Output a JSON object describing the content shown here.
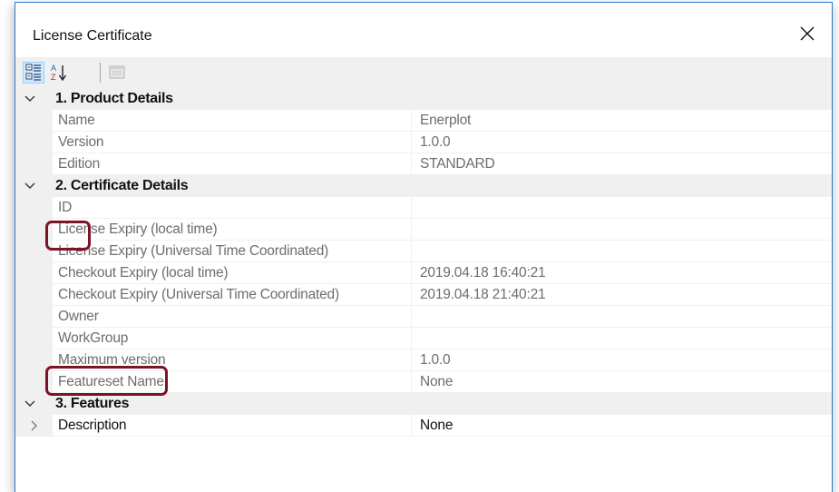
{
  "window": {
    "title": "License Certificate"
  },
  "toolbar": {
    "buttons": [
      "categorized-icon",
      "alphabetical-icon",
      "property-pages-icon"
    ]
  },
  "grid": {
    "categories": [
      {
        "label": "1. Product Details",
        "expanded": true,
        "rows": [
          {
            "name": "Name",
            "value": "Enerplot"
          },
          {
            "name": "Version",
            "value": "1.0.0"
          },
          {
            "name": "Edition",
            "value": "STANDARD"
          }
        ]
      },
      {
        "label": "2. Certificate Details",
        "expanded": true,
        "rows": [
          {
            "name": "ID",
            "value": ""
          },
          {
            "name": "License Expiry (local time)",
            "value": ""
          },
          {
            "name": "License Expiry (Universal Time Coordinated)",
            "value": ""
          },
          {
            "name": "Checkout Expiry (local time)",
            "value": "2019.04.18 16:40:21"
          },
          {
            "name": "Checkout Expiry (Universal Time Coordinated)",
            "value": "2019.04.18 21:40:21"
          },
          {
            "name": "Owner",
            "value": ""
          },
          {
            "name": "WorkGroup",
            "value": ""
          },
          {
            "name": "Maximum version",
            "value": "1.0.0"
          },
          {
            "name": "Featureset Name",
            "value": "None"
          }
        ]
      },
      {
        "label": "3. Features",
        "expanded": true,
        "rows": [
          {
            "name": "Description",
            "value": "None",
            "expandable": true
          }
        ]
      }
    ]
  },
  "colors": {
    "highlight": "#7b1526",
    "accent": "#2b78d0",
    "gutter": "#f0f0f0"
  }
}
